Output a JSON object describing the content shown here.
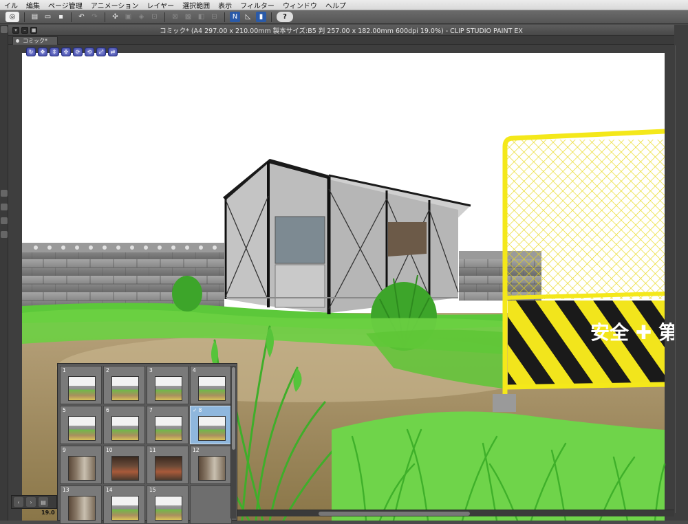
{
  "menubar": {
    "items": [
      "イル",
      "編集",
      "ページ管理",
      "アニメーション",
      "レイヤー",
      "選択範囲",
      "表示",
      "フィルター",
      "ウィンドウ",
      "ヘルプ"
    ]
  },
  "toolbar": {
    "buttons": [
      {
        "name": "clip-studio-icon",
        "glyph": "◎"
      },
      {
        "name": "new-file-icon",
        "glyph": "▤"
      },
      {
        "name": "open-file-icon",
        "glyph": "▭"
      },
      {
        "name": "save-icon",
        "glyph": "▪"
      },
      {
        "name": "undo-icon",
        "glyph": "↶"
      },
      {
        "name": "redo-icon",
        "glyph": "↷"
      },
      {
        "name": "transform-icon",
        "glyph": "✣"
      },
      {
        "name": "help-icon",
        "glyph": "?"
      }
    ]
  },
  "window": {
    "title": "コミック* (A4 297.00 x 210.00mm 製本サイズ:B5 判 257.00 x 182.00mm 600dpi 19.0%)  - CLIP STUDIO PAINT EX"
  },
  "tab": {
    "label": "コミック*"
  },
  "scene": {
    "sign_text": "安全 ✚ 第",
    "colors": {
      "sky": "#ffffff",
      "fence_yellow": "#f4e81a",
      "wall_gray": "#8e8e8e",
      "grass": "#5fc63a",
      "ground": "#a08a60",
      "shed": "#bfbfbf"
    }
  },
  "thumbnails": {
    "items": [
      {
        "num": "1",
        "tone": "outdoor"
      },
      {
        "num": "2",
        "tone": "outdoor"
      },
      {
        "num": "3",
        "tone": "outdoor"
      },
      {
        "num": "4",
        "tone": "outdoor"
      },
      {
        "num": "5",
        "tone": "outdoor"
      },
      {
        "num": "6",
        "tone": "outdoor"
      },
      {
        "num": "7",
        "tone": "outdoor"
      },
      {
        "num": "✓ 8",
        "tone": "outdoor",
        "selected": true
      },
      {
        "num": "9",
        "tone": "indoor"
      },
      {
        "num": "10",
        "tone": "indoor-dark"
      },
      {
        "num": "11",
        "tone": "indoor-dark"
      },
      {
        "num": "12",
        "tone": "indoor"
      },
      {
        "num": "13",
        "tone": "indoor"
      },
      {
        "num": "14",
        "tone": "outdoor"
      },
      {
        "num": "15",
        "tone": "outdoor"
      },
      {
        "num": "",
        "tone": "empty"
      }
    ]
  },
  "status": {
    "zoom": "19.0"
  }
}
